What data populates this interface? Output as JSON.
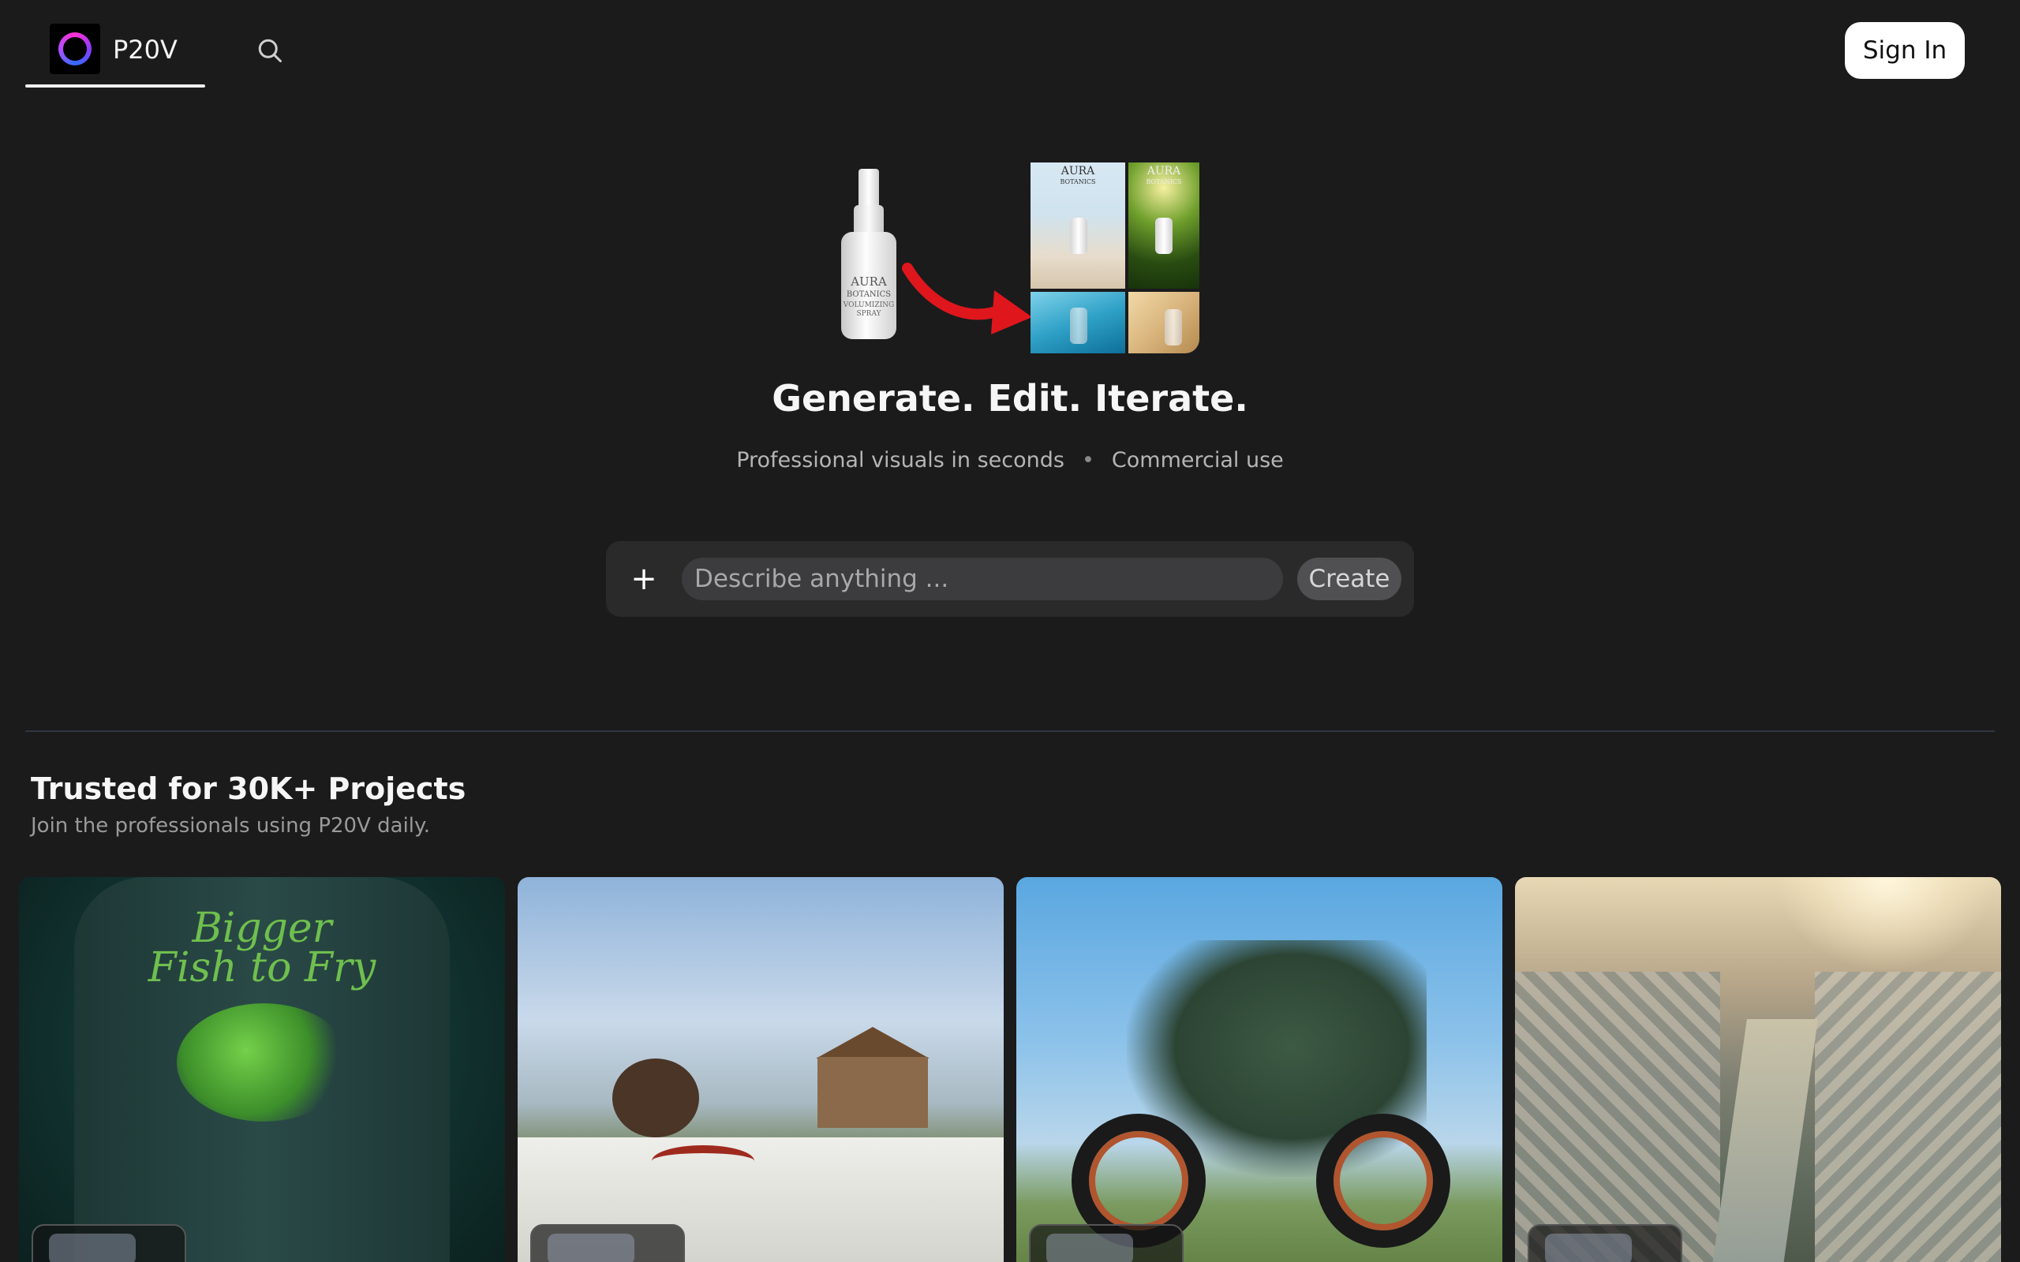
{
  "header": {
    "brand_name": "P20V",
    "sign_in_label": "Sign In"
  },
  "hero": {
    "bottle_label": "AURA",
    "bottle_sublabel": "BOTANICS",
    "bottle_fineprint": "VOLUMIZING SPRAY",
    "collage_brand": "AURA",
    "collage_sub": "BOTANICS",
    "headline": "Generate. Edit. Iterate.",
    "subline_left": "Professional visuals in seconds",
    "subline_sep": "•",
    "subline_right": "Commercial use"
  },
  "prompt": {
    "add_label": "+",
    "placeholder": "Describe anything ...",
    "value": "",
    "create_label": "Create"
  },
  "trusted": {
    "title": "Trusted for 30K+ Projects",
    "subtitle": "Join the professionals using P20V daily."
  },
  "gallery": {
    "cards": [
      {
        "subject": "t-shirt print",
        "shirt_line1": "Bigger",
        "shirt_line2": "Fish to Fry"
      },
      {
        "subject": "japanese garden"
      },
      {
        "subject": "motorcycle"
      },
      {
        "subject": "aerial city"
      }
    ]
  },
  "colors": {
    "background": "#1b1b1c",
    "prompt_bar": "#2a2a2b",
    "create_button": "#505052",
    "accent_arrow": "#e0161d"
  },
  "icons": {
    "search": "search-icon",
    "logo": "ring-logo-icon",
    "arrow": "curved-arrow-icon"
  }
}
